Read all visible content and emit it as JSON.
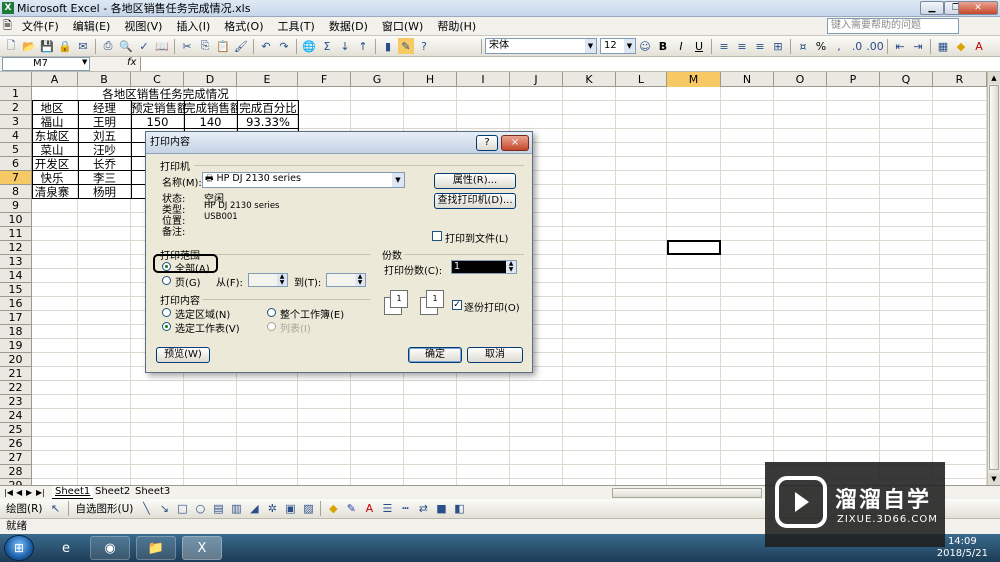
{
  "window": {
    "title": "Microsoft Excel - 各地区销售任务完成情况.xls"
  },
  "menu": [
    "文件(F)",
    "编辑(E)",
    "视图(V)",
    "插入(I)",
    "格式(O)",
    "工具(T)",
    "数据(D)",
    "窗口(W)",
    "帮助(H)"
  ],
  "help_placeholder": "键入需要帮助的问题",
  "toolbar": {
    "font_name": "宋体",
    "font_size": "12",
    "bold": "B",
    "italic": "I",
    "underline": "U",
    "sum": "Σ",
    "percent": "%"
  },
  "formula_bar": {
    "name_box": "M7",
    "fx": "fx"
  },
  "columns": [
    "A",
    "B",
    "C",
    "D",
    "E",
    "F",
    "G",
    "H",
    "I",
    "J",
    "K",
    "L",
    "M",
    "N",
    "O",
    "P",
    "Q",
    "R"
  ],
  "rows": [
    "1",
    "2",
    "3",
    "4",
    "5",
    "6",
    "7",
    "8",
    "9",
    "10",
    "11",
    "12",
    "13",
    "14",
    "15",
    "16",
    "17",
    "18",
    "19",
    "20",
    "21",
    "22",
    "23",
    "24",
    "25",
    "26",
    "27",
    "28",
    "29"
  ],
  "sheet": {
    "title": "各地区销售任务完成情况",
    "headers": [
      "地区",
      "经理",
      "预定销售额",
      "完成销售额",
      "完成百分比"
    ],
    "data": [
      [
        "福山",
        "王明",
        "150",
        "140",
        "93.33%"
      ],
      [
        "东城区",
        "刘五",
        "",
        "",
        ""
      ],
      [
        "菜山",
        "汪吵",
        "",
        "",
        ""
      ],
      [
        "开发区",
        "长乔",
        "",
        "",
        ""
      ],
      [
        "快乐",
        "李三",
        "",
        "",
        ""
      ],
      [
        "清泉寨",
        "杨明",
        "",
        "",
        ""
      ]
    ]
  },
  "sheet_tabs": [
    "Sheet1",
    "Sheet2",
    "Sheet3"
  ],
  "drawing_toolbar": {
    "draw": "绘图(R)",
    "autoshapes": "自选图形(U)"
  },
  "status": "就绪",
  "dialog": {
    "title": "打印内容",
    "help": "?",
    "close": "×",
    "printer_group": "打印机",
    "name_label": "名称(M):",
    "printer_name": "HP DJ 2130 series",
    "properties_button": "属性(R)...",
    "find_printer_button": "查找打印机(D)...",
    "status_label": "状态:",
    "status_value": "空闲",
    "type_label": "类型:",
    "type_value": "HP DJ 2130 series",
    "where_label": "位置:",
    "where_value": "USB001",
    "comment_label": "备注:",
    "print_to_file": "打印到文件(L)",
    "range_group": "打印范围",
    "all": "全部(A)",
    "pages": "页(G)",
    "from": "从(F):",
    "to": "到(T):",
    "copies_group": "份数",
    "copies_label": "打印份数(C):",
    "copies_value": "1",
    "collate": "逐份打印(O)",
    "content_group": "打印内容",
    "selection": "选定区域(N)",
    "entire_workbook": "整个工作簿(E)",
    "active_sheets": "选定工作表(V)",
    "list": "列表(I)",
    "preview_button": "预览(W)",
    "ok_button": "确定",
    "cancel_button": "取消"
  },
  "taskbar": {
    "time": "14:09",
    "date": "2018/5/21"
  },
  "watermark": {
    "brand": "溜溜自学",
    "url": "ZIXUE.3D66.COM"
  }
}
